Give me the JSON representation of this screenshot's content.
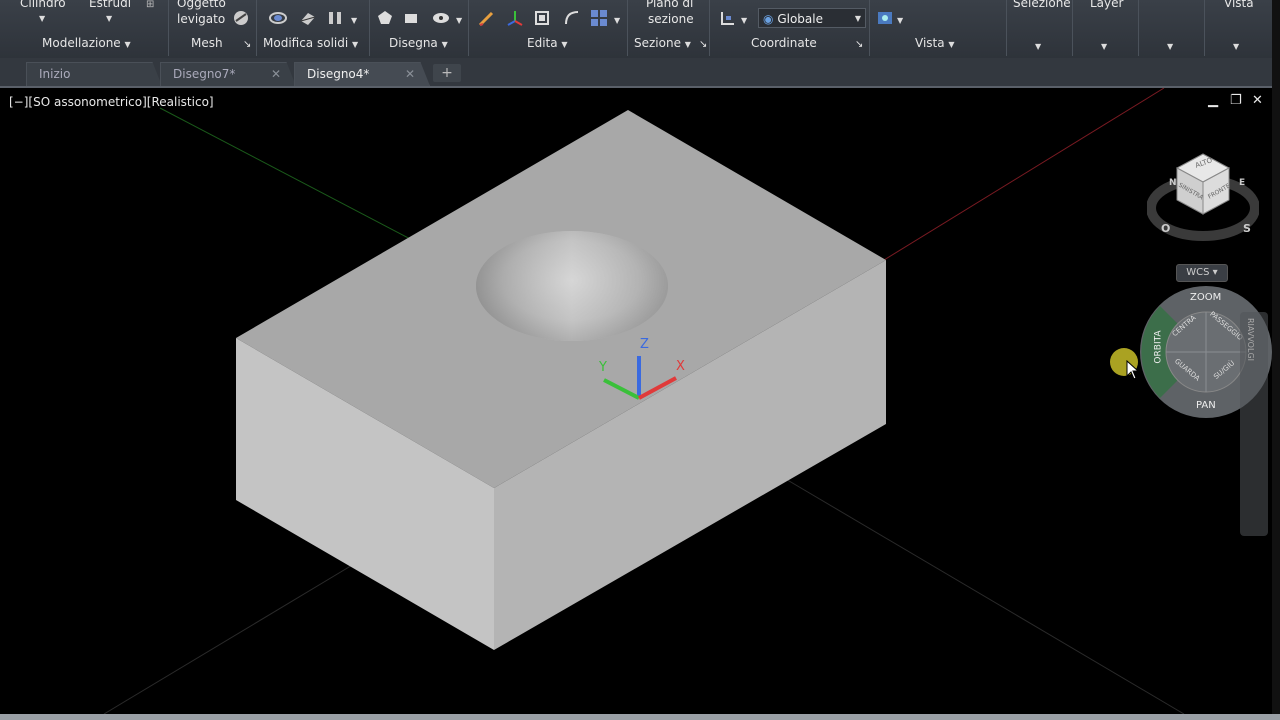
{
  "ribbon": {
    "cylinder_label": "Cilindro",
    "extrude_label": "Estrudi",
    "smooth_object_label_1": "Oggetto",
    "smooth_object_label_2": "levigato",
    "section_plane_label_1": "Piano di",
    "section_plane_label_2": "sezione",
    "coords_combo_value": "Globale",
    "selection_label": "Selezione",
    "layer_label": "Layer",
    "view_label": "Vista",
    "panels": {
      "modeling": "Modellazione",
      "mesh": "Mesh",
      "solid_edit": "Modifica solidi",
      "draw": "Disegna",
      "edit": "Edita",
      "section": "Sezione",
      "coordinates": "Coordinate",
      "view": "Vista"
    }
  },
  "tabs": [
    {
      "label": "Inizio"
    },
    {
      "label": "Disegno7*"
    },
    {
      "label": "Disegno4*"
    }
  ],
  "viewport": {
    "label": "[−][SO assonometrico][Realistico]"
  },
  "viewcube": {
    "top": "ALTO",
    "left": "SINISTRA",
    "front": "FRONTE",
    "compass_w": "O",
    "compass_s": "S",
    "compass_n": "N",
    "compass_e": "E",
    "wcs": "WCS"
  },
  "steering_wheel": {
    "zoom": "ZOOM",
    "orbit": "ORBITA",
    "pan": "PAN",
    "center": "CENTRA",
    "walk": "PASSEGGIO",
    "look": "GUARDA",
    "up_down": "SU/GIÙ",
    "rewind": "RIAVVOLGI"
  },
  "ucs_icon": {
    "x": "X",
    "y": "Y",
    "z": "Z"
  },
  "colors": {
    "ucs_x": "#e03a3a",
    "ucs_y": "#3ac03a",
    "ucs_z": "#3a6ae0",
    "axis_red": "#7a1a22",
    "axis_green": "#1a5a1a"
  }
}
